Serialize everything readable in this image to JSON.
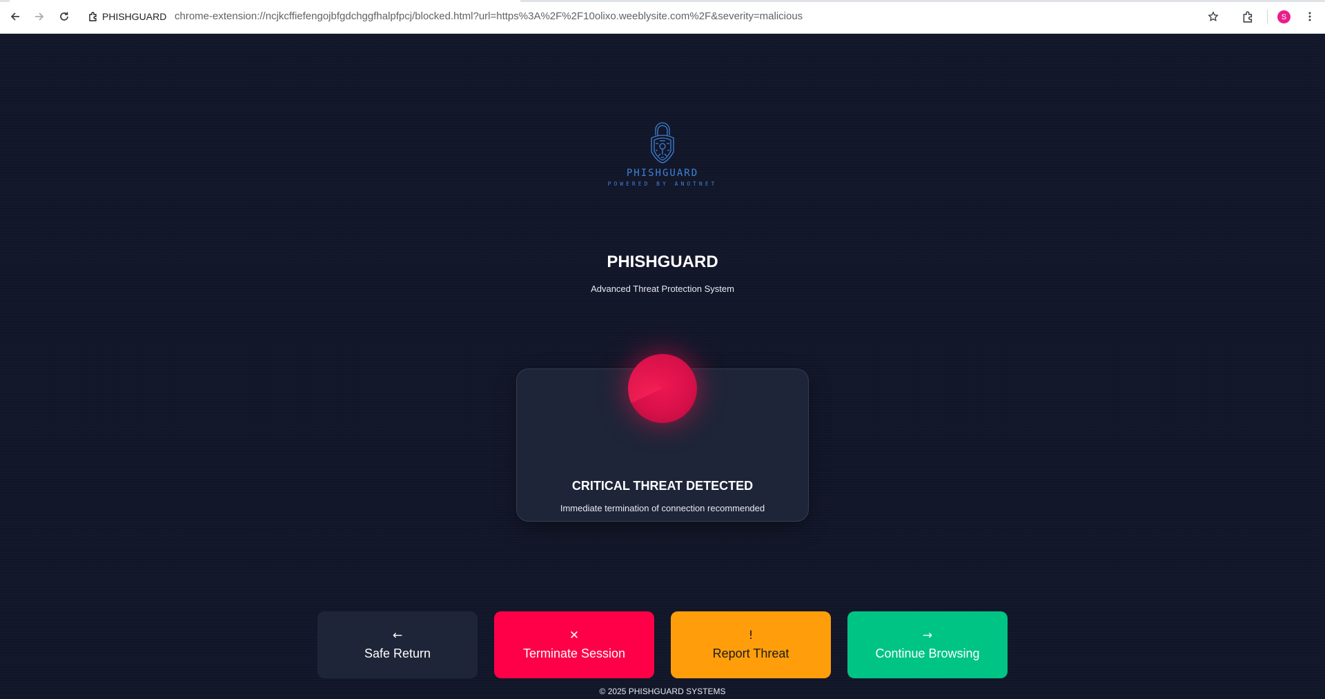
{
  "browser": {
    "tab_title": "PHISHGUARD",
    "url": "chrome-extension://ncjkcffiefengojbfgdchggfhalpfpcj/blocked.html?url=https%3A%2F%2F10olixo.weeblysite.com%2F&severity=malicious",
    "profile_initial": "S",
    "icons": {
      "back": "back-arrow-icon",
      "forward": "forward-arrow-icon",
      "reload": "reload-icon",
      "bookmark": "star-icon",
      "extensions": "puzzle-icon",
      "menu": "kebab-menu-icon"
    }
  },
  "logo": {
    "name": "PHISHGUARD",
    "tagline": "POWERED BY ANOTNET"
  },
  "header": {
    "title": "PHISHGUARD",
    "subtitle": "Advanced Threat Protection System"
  },
  "threat": {
    "title": "CRITICAL THREAT DETECTED",
    "description": "Immediate termination of connection recommended"
  },
  "actions": [
    {
      "glyph": "←",
      "label": "Safe Return"
    },
    {
      "glyph": "✕",
      "label": "Terminate Session"
    },
    {
      "glyph": "!",
      "label": "Report Threat"
    },
    {
      "glyph": "→",
      "label": "Continue Browsing"
    }
  ],
  "footer": {
    "text": "© 2025 PHISHGUARD SYSTEMS"
  },
  "colors": {
    "background": "#121629",
    "card": "#1e2538",
    "danger": "#ff0048",
    "warning": "#ff9e0a",
    "success": "#00c484",
    "logo_blue": "#3c84d8"
  }
}
